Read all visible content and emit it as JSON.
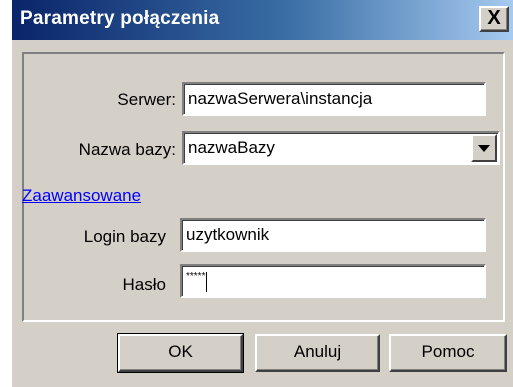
{
  "window": {
    "title": "Parametry połączenia",
    "close_label": "X"
  },
  "form": {
    "server_label": "Serwer:",
    "server_value": "nazwaSerwera\\instancja",
    "db_label": "Nazwa bazy:",
    "db_value": "nazwaBazy",
    "advanced_link": "Zaawansowane",
    "login_label": "Login bazy",
    "login_value": "uzytkownik",
    "password_label": "Hasło",
    "password_value": "*****"
  },
  "buttons": {
    "ok": "OK",
    "cancel": "Anuluj",
    "help": "Pomoc"
  }
}
